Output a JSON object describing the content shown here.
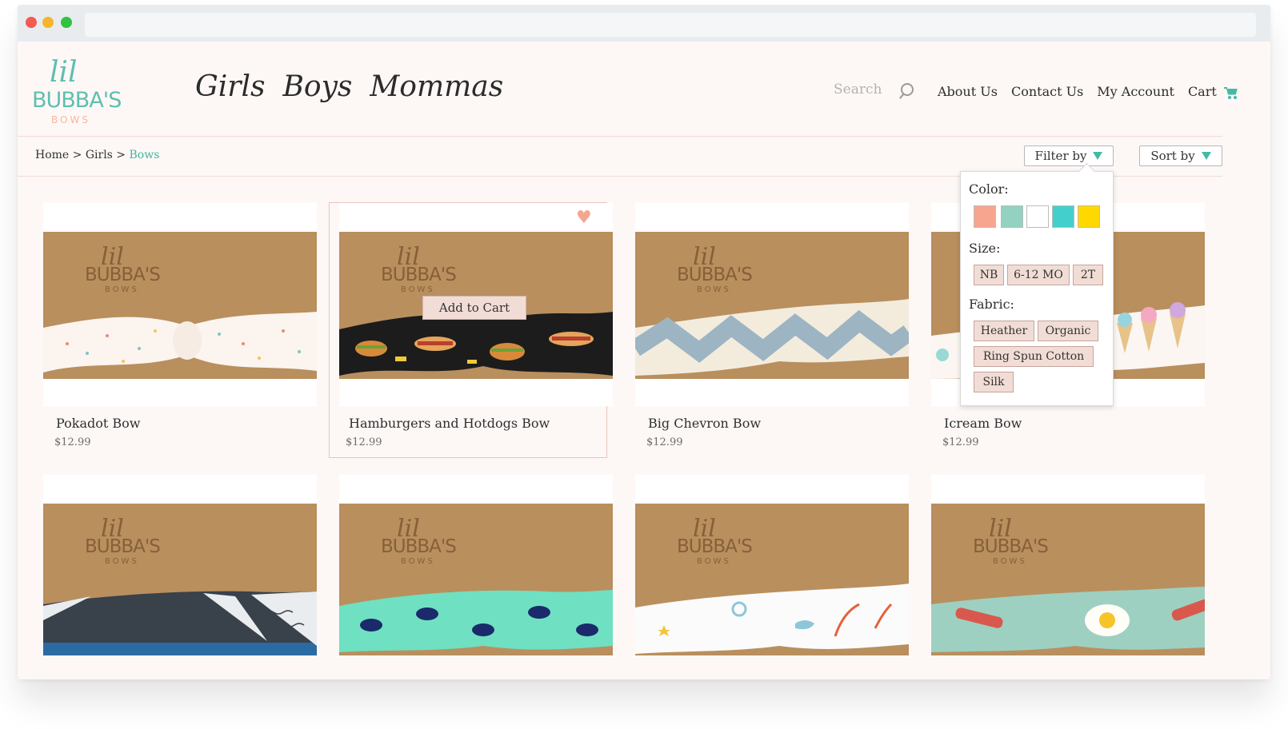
{
  "brand": {
    "lil": "lil",
    "name": "BUBBA'S",
    "sub": "BOWS"
  },
  "main_nav": [
    "Girls",
    "Boys",
    "Mommas"
  ],
  "search": {
    "placeholder": "Search"
  },
  "top_nav": {
    "about": "About Us",
    "contact": "Contact Us",
    "account": "My Account",
    "cart": "Cart"
  },
  "breadcrumb": {
    "home": "Home",
    "sep": " > ",
    "girls": "Girls",
    "current": "Bows"
  },
  "controls": {
    "filter": "Filter by",
    "sort": "Sort by"
  },
  "filter": {
    "color_label": "Color:",
    "colors": [
      "#f7a58f",
      "#93d1c0",
      "#ffffff",
      "#43d0cc",
      "#ffd800"
    ],
    "size_label": "Size:",
    "sizes": [
      "NB",
      "6-12 MO",
      "2T"
    ],
    "fabric_label": "Fabric:",
    "fabrics": [
      "Heather",
      "Organic",
      "Ring Spun Cotton",
      "Silk"
    ]
  },
  "product_brand": {
    "l": "lil",
    "b": "BUBBA'S",
    "s": "BOWS"
  },
  "products": [
    {
      "title": "Pokadot Bow",
      "price": "$12.99"
    },
    {
      "title": "Hamburgers and Hotdogs Bow",
      "price": "$12.99"
    },
    {
      "title": "Big Chevron Bow",
      "price": "$12.99"
    },
    {
      "title": "Icream Bow",
      "price": "$12.99"
    }
  ],
  "hover_card": {
    "add_to_cart": "Add to Cart"
  },
  "colors": {
    "accent": "#46b9a6",
    "button_fill": "#f1ddd6",
    "kraft": "#b98f5e",
    "page_bg": "#fdf8f6"
  }
}
